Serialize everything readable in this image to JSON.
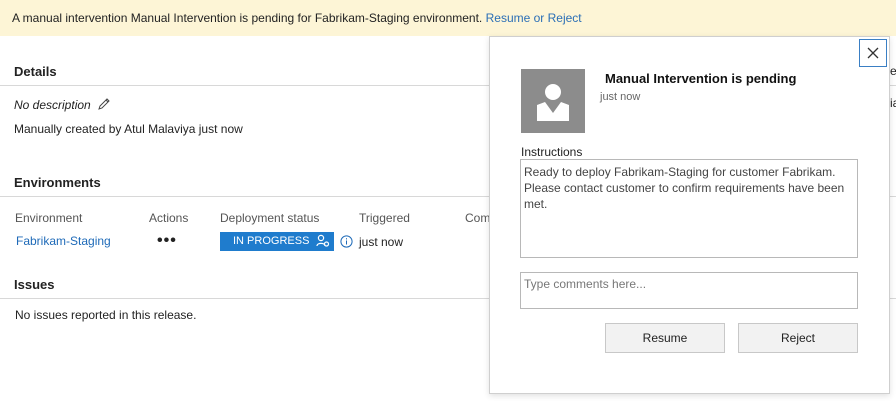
{
  "banner": {
    "message": "A manual intervention Manual Intervention is pending for Fabrikam-Staging environment.",
    "action_link": "Resume or Reject",
    "background": "#fdf5d6"
  },
  "details": {
    "title": "Details",
    "description": "No description",
    "created": "Manually created by Atul Malaviya just now",
    "edit_icon": "pencil-icon"
  },
  "environments": {
    "title": "Environments",
    "columns": [
      "Environment",
      "Actions",
      "Deployment status",
      "Triggered",
      "Com"
    ],
    "rows": [
      {
        "environment": "Fabrikam-Staging",
        "actions": "•••",
        "status": "IN PROGRESS",
        "triggered": "just now"
      }
    ],
    "status_color": "#1f7ccd"
  },
  "issues": {
    "title": "Issues",
    "message": "No issues reported in this release."
  },
  "panel": {
    "title": "Manual Intervention is pending",
    "time": "just now",
    "instructions_label": "Instructions",
    "instructions": "Ready to deploy Fabrikam-Staging for customer Fabrikam.\nPlease contact customer to confirm requirements have been\nmet.",
    "comments_placeholder": "Type comments here...",
    "resume_label": "Resume",
    "reject_label": "Reject",
    "close_icon": "close-icon",
    "avatar_icon": "user-avatar-icon"
  }
}
